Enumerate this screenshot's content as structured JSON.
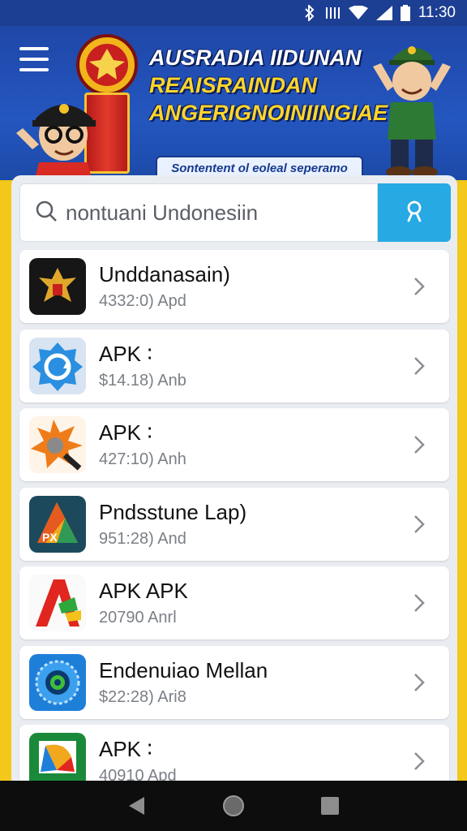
{
  "status_bar": {
    "time": "11:30",
    "icons": [
      "bluetooth-icon",
      "vibrate-icon",
      "wifi-icon",
      "signal-icon",
      "battery-icon"
    ]
  },
  "header": {
    "menu_icon": "menu-icon",
    "banner_line1": "AUSRADIA IIDUNAN",
    "banner_line2": "REAISRAINDAN",
    "banner_line3": "ANGERIGNOINIINGIAE",
    "banner_subtitle": "Sontentent ol eoleal seperamo"
  },
  "search": {
    "placeholder": "nontuani Undonesiin",
    "value": "",
    "search_icon": "search-icon",
    "button_icon": "user-search-icon"
  },
  "apps": [
    {
      "name": "Unddanasain)",
      "meta": "4332:0) Apd",
      "icon": "garuda-emblem-icon"
    },
    {
      "name": "APK ∶",
      "meta": "$14.18) Anb",
      "icon": "blue-gear-refresh-icon"
    },
    {
      "name": "APK ∶",
      "meta": "427:10) Anh",
      "icon": "orange-star-tool-icon"
    },
    {
      "name": "Pndsstune Lap)",
      "meta": "951:28) And",
      "icon": "px-triangle-icon"
    },
    {
      "name": "APK APK",
      "meta": "20790 Anrl",
      "icon": "red-green-a-icon"
    },
    {
      "name": "Endenuiao Mellan",
      "meta": "$22:28) Ari8",
      "icon": "blue-camera-lens-icon"
    },
    {
      "name": "APK ∶",
      "meta": "40910 Apd",
      "icon": "colorful-play-icon"
    }
  ],
  "colors": {
    "header_blue": "#2456bf",
    "page_yellow": "#f3c81a",
    "search_button": "#27a9e4",
    "card_bg": "#e9ecf1"
  },
  "nav_bar": {
    "back_icon": "back-triangle-icon",
    "home_icon": "home-circle-icon",
    "recents_icon": "recents-square-icon"
  }
}
